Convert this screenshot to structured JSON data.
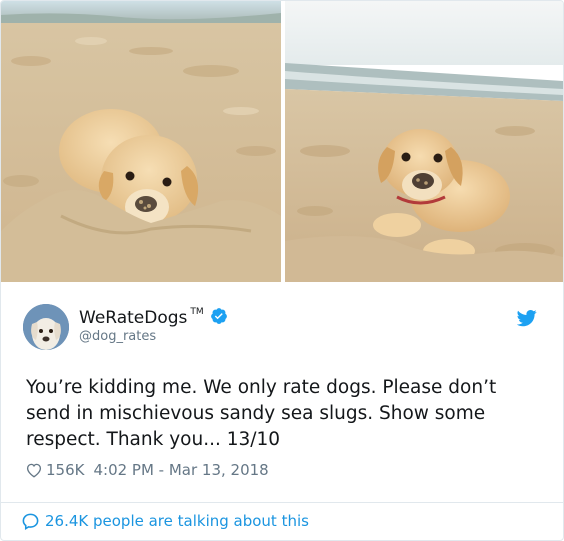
{
  "images": [
    {
      "alt": "puppy buried in beach sand"
    },
    {
      "alt": "puppy lying on beach sand"
    }
  ],
  "author": {
    "name": "WeRateDogs",
    "trademark": "TM",
    "handle": "@dog_rates",
    "verified": true
  },
  "tweet": {
    "text": "You’re kidding me. We only rate dogs. Please don’t send in mischievous sandy sea slugs. Show some respect. Thank you... 13/10",
    "likes": "156K",
    "timestamp": "4:02 PM - Mar 13, 2018"
  },
  "footer": {
    "talking": "26.4K people are talking about this"
  },
  "colors": {
    "twitter_blue": "#1da1f2",
    "link_blue": "#1b95e0",
    "muted_gray": "#657786",
    "border": "#e1e8ed"
  },
  "icons": {
    "verified": "verified-badge-icon",
    "bird": "twitter-bird-icon",
    "like": "heart-outline-icon",
    "reply": "speech-bubble-icon"
  }
}
